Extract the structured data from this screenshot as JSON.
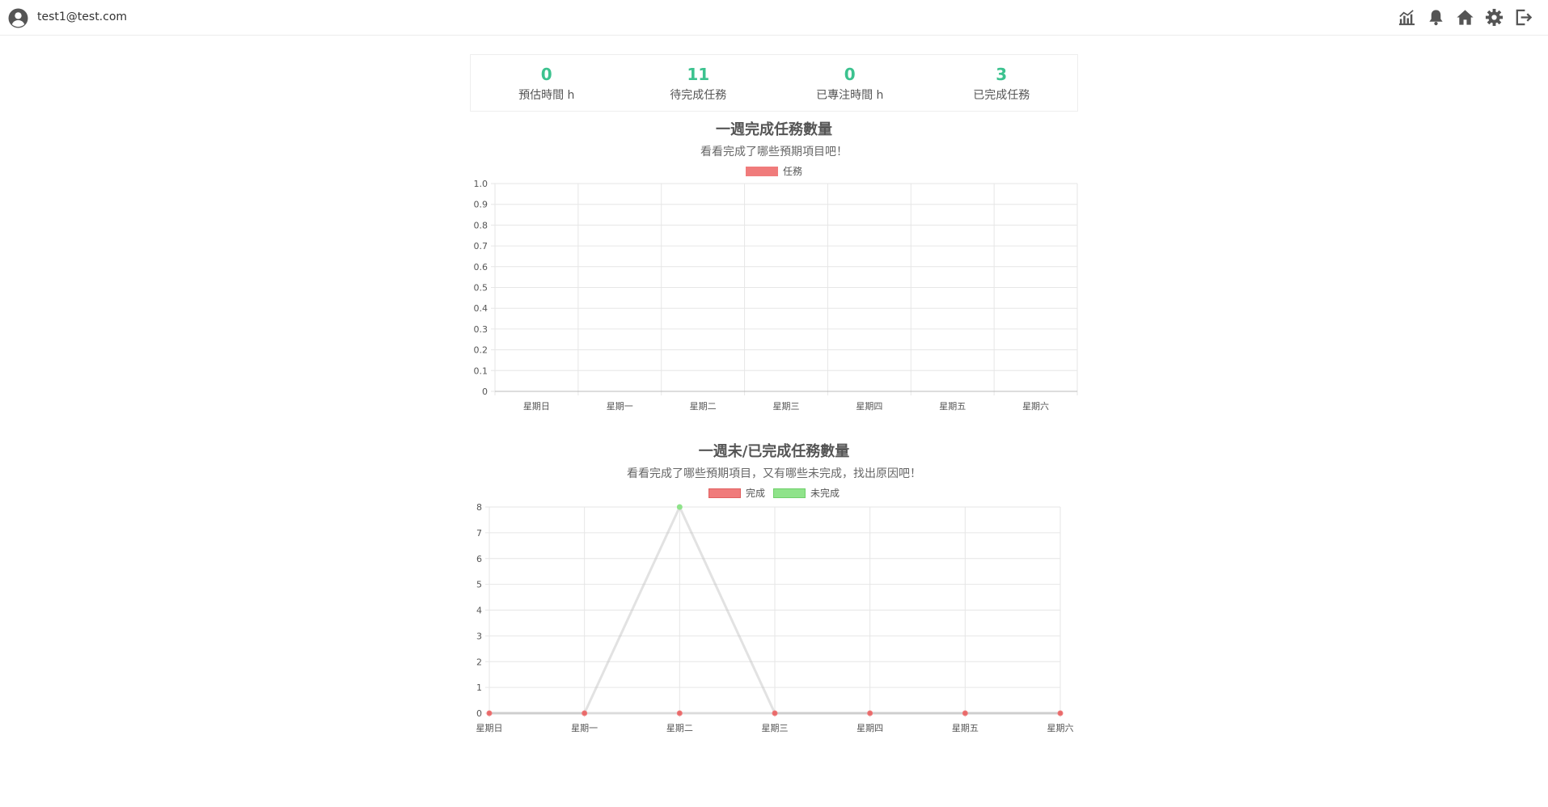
{
  "header": {
    "user_email": "test1@test.com",
    "nav_icons": [
      "chart-icon",
      "bell-icon",
      "home-icon",
      "gear-icon",
      "logout-icon"
    ]
  },
  "stats": [
    {
      "value": "0",
      "label": "預估時間 h"
    },
    {
      "value": "11",
      "label": "待完成任務"
    },
    {
      "value": "0",
      "label": "已專注時間 h"
    },
    {
      "value": "3",
      "label": "已完成任務"
    }
  ],
  "colors": {
    "accent": "#3cc28f",
    "done": "#f07b7b",
    "undone": "#8fe38a",
    "grid": "#e6e6e6"
  },
  "chart_data": [
    {
      "type": "bar",
      "title": "一週完成任務數量",
      "subtitle": "看看完成了哪些預期項目吧！",
      "categories": [
        "星期日",
        "星期一",
        "星期二",
        "星期三",
        "星期四",
        "星期五",
        "星期六"
      ],
      "series": [
        {
          "name": "任務",
          "values": [
            0,
            0,
            0,
            0,
            0,
            0,
            0
          ]
        }
      ],
      "yticks": [
        "1.0",
        "0.9",
        "0.8",
        "0.7",
        "0.6",
        "0.5",
        "0.4",
        "0.3",
        "0.2",
        "0.1",
        "0"
      ],
      "ylim": [
        0,
        1
      ],
      "grid": true,
      "legend": "top-center"
    },
    {
      "type": "line",
      "title": "一週未/已完成任務數量",
      "subtitle": "看看完成了哪些預期項目，又有哪些未完成，找出原因吧！",
      "categories": [
        "星期日",
        "星期一",
        "星期二",
        "星期三",
        "星期四",
        "星期五",
        "星期六"
      ],
      "series": [
        {
          "name": "完成",
          "values": [
            0,
            0,
            0,
            0,
            0,
            0,
            0
          ]
        },
        {
          "name": "未完成",
          "values": [
            0,
            0,
            8,
            0,
            0,
            0,
            0
          ]
        }
      ],
      "yticks": [
        "8",
        "7",
        "6",
        "5",
        "4",
        "3",
        "2",
        "1",
        "0"
      ],
      "ylim": [
        0,
        8
      ],
      "grid": true,
      "legend": "top-center"
    }
  ]
}
